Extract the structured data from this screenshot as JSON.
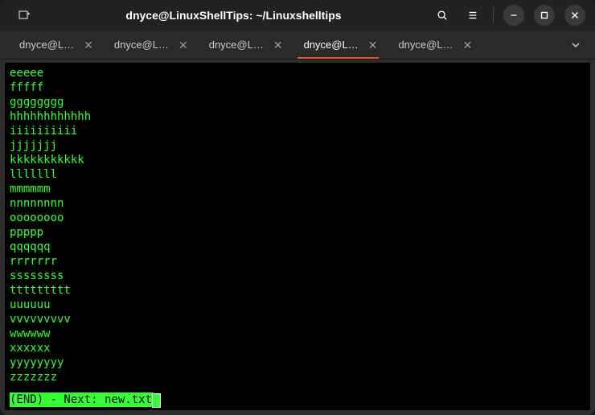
{
  "window": {
    "title": "dnyce@LinuxShellTips: ~/Linuxshelltips"
  },
  "tabs": {
    "items": [
      {
        "label": "dnyce@L…",
        "active": false
      },
      {
        "label": "dnyce@L…",
        "active": false
      },
      {
        "label": "dnyce@L…",
        "active": false
      },
      {
        "label": "dnyce@L…",
        "active": true
      },
      {
        "label": "dnyce@L…",
        "active": false
      }
    ]
  },
  "terminal": {
    "lines": [
      "eeeee",
      "fffff",
      "gggggggg",
      "hhhhhhhhhhhh",
      "iiiiiiiiii",
      "jjjjjjj",
      "kkkkkkkkkkk",
      "lllllll",
      "mmmmmm",
      "nnnnnnnn",
      "oooooooo",
      "ppppp",
      "qqqqqq",
      "rrrrrrr",
      "ssssssss",
      "ttttttttt",
      "uuuuuu",
      "vvvvvvvvv",
      "wwwwww",
      "xxxxxx",
      "yyyyyyyy",
      "zzzzzzz"
    ],
    "status": "(END) - Next: new.txt"
  },
  "colors": {
    "accent": "#e95420",
    "term_fg": "#33ff33",
    "term_bg": "#000000"
  }
}
